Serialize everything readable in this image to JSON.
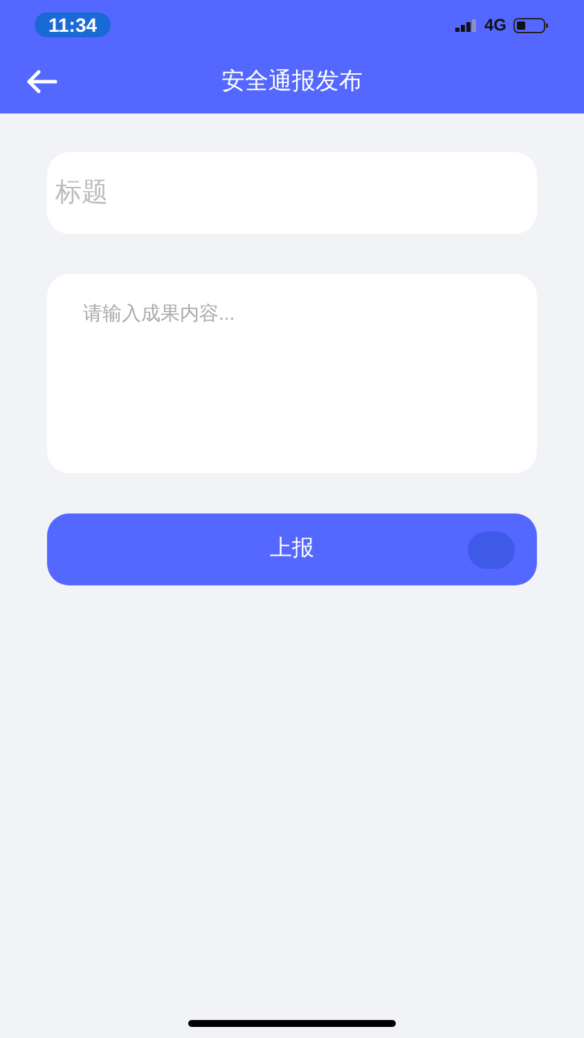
{
  "status_bar": {
    "time": "11:34",
    "network": "4G"
  },
  "header": {
    "title": "安全通报发布"
  },
  "title_field": {
    "placeholder": "标题"
  },
  "content_field": {
    "placeholder": "请输入成果内容..."
  },
  "submit_button": {
    "label": "上报"
  }
}
